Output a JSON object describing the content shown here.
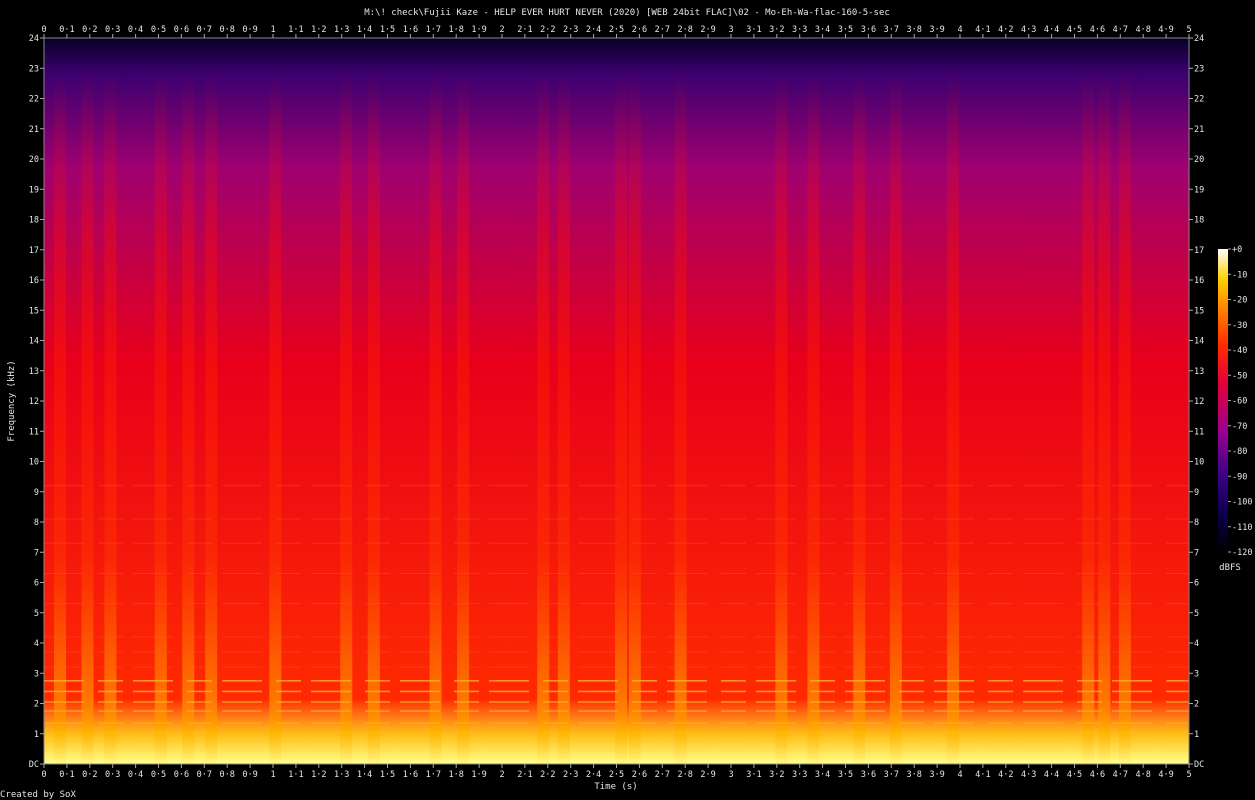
{
  "chart_data": {
    "type": "heatmap",
    "title": "M:\\! check\\Fujii Kaze - HELP EVER HURT NEVER (2020) [WEB 24bit FLAC]\\02 - Mo-Eh-Wa-flac-160-5-sec",
    "xlabel": "Time (s)",
    "ylabel": "Frequency (kHz)",
    "xlim": [
      0,
      5
    ],
    "ylim": [
      0,
      24
    ],
    "x_ticks": [
      "0",
      "0·1",
      "0·2",
      "0·3",
      "0·4",
      "0·5",
      "0·6",
      "0·7",
      "0·8",
      "0·9",
      "1",
      "1·1",
      "1·2",
      "1·3",
      "1·4",
      "1·5",
      "1·6",
      "1·7",
      "1·8",
      "1·9",
      "2",
      "2·1",
      "2·2",
      "2·3",
      "2·4",
      "2·5",
      "2·6",
      "2·7",
      "2·8",
      "2·9",
      "3",
      "3·1",
      "3·2",
      "3·3",
      "3·4",
      "3·5",
      "3·6",
      "3·7",
      "3·8",
      "3·9",
      "4",
      "4·1",
      "4·2",
      "4·3",
      "4·4",
      "4·5",
      "4·6",
      "4·7",
      "4·8",
      "4·9",
      "5"
    ],
    "y_ticks": [
      "DC",
      "1",
      "2",
      "3",
      "4",
      "5",
      "6",
      "7",
      "8",
      "9",
      "10",
      "11",
      "12",
      "13",
      "14",
      "15",
      "16",
      "17",
      "18",
      "19",
      "20",
      "21",
      "22",
      "23",
      "24"
    ],
    "colorbar": {
      "label": "dBFS",
      "range": [
        -120,
        0
      ],
      "ticks": [
        "+0",
        "-10",
        "-20",
        "-30",
        "-40",
        "-50",
        "-60",
        "-70",
        "-80",
        "-90",
        "-100",
        "-110",
        "-120"
      ]
    },
    "grid": false,
    "transients_s": [
      0.07,
      0.19,
      0.29,
      0.51,
      0.63,
      0.73,
      1.01,
      1.32,
      1.44,
      1.71,
      1.83,
      2.18,
      2.27,
      2.52,
      2.58,
      2.78,
      3.22,
      3.36,
      3.56,
      3.72,
      3.97,
      4.56,
      4.63,
      4.72
    ],
    "harmonic_lines_khz": [
      0.45,
      0.75,
      1.05,
      1.35,
      1.75,
      2.05,
      2.4,
      2.75,
      3.2,
      3.7,
      4.2,
      5.3,
      6.3,
      7.3,
      8.1,
      9.2
    ]
  },
  "footer": {
    "credit": "Created by SoX"
  }
}
